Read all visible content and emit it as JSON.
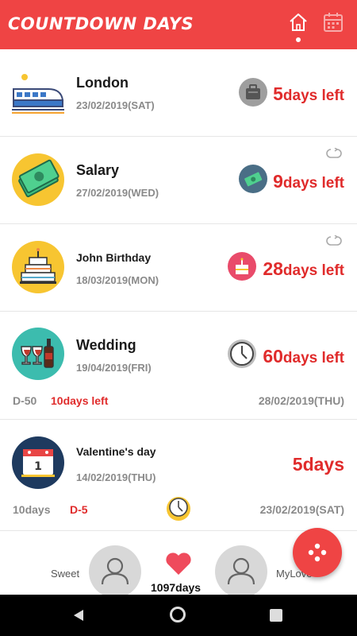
{
  "header": {
    "title": "COUNTDOWN DAYS",
    "home_icon": "home-icon",
    "calendar_icon": "calendar-icon",
    "bg_color": "#ef4444"
  },
  "events": [
    {
      "name": "London",
      "date": "23/02/2019(SAT)",
      "days": "5",
      "suffix": "days left",
      "avatar_icon": "train-icon",
      "mini_icon": "luggage-icon"
    },
    {
      "name": "Salary",
      "date": "27/02/2019(WED)",
      "days": "9",
      "suffix": "days left",
      "avatar_icon": "money-icon",
      "mini_icon": "money-icon",
      "repeat": "repeat-icon"
    },
    {
      "name": "John Birthday",
      "date": "18/03/2019(MON)",
      "days": "28",
      "suffix": "days left",
      "avatar_icon": "cake-icon",
      "mini_icon": "cake-icon",
      "repeat": "repeat-icon"
    },
    {
      "name": "Wedding",
      "date": "19/04/2019(FRI)",
      "days": "60",
      "suffix": "days left",
      "avatar_icon": "wine-icon",
      "mini_icon": "clock-icon",
      "sub": {
        "dday": "D-50",
        "left": "10days left",
        "date": "28/02/2019(THU)"
      }
    },
    {
      "name": "Valentine's day",
      "date": "14/02/2019(THU)",
      "days": "5",
      "suffix": "days",
      "avatar_icon": "calendar-icon",
      "mini_icon": "",
      "sub": {
        "dday": "10days",
        "left": "D-5",
        "date": "23/02/2019(SAT)",
        "icon": "clock-icon"
      }
    }
  ],
  "couple": {
    "left_name": "Sweet",
    "right_name": "MyLove",
    "total": "1097days",
    "heart_icon": "heart-icon",
    "left_avatar": "person-icon",
    "right_avatar": "person-icon"
  },
  "fab": {
    "icon": "dots-icon"
  },
  "navbar": {
    "back": "back-icon",
    "home": "home-circle-icon",
    "recent": "recent-apps-icon"
  },
  "colors": {
    "accent": "#ef4444",
    "countdown_red": "#e02b2b",
    "gray_text": "#8a8a8a"
  }
}
